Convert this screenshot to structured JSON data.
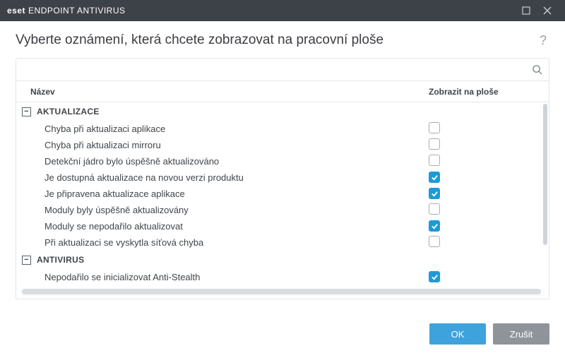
{
  "titlebar": {
    "brand_bold": "eset",
    "brand_rest": "ENDPOINT ANTIVIRUS"
  },
  "header": {
    "title": "Vyberte oznámení, která chcete zobrazovat na pracovní ploše"
  },
  "search": {
    "placeholder": ""
  },
  "columns": {
    "name": "Název",
    "show": "Zobrazit na ploše"
  },
  "groups": [
    {
      "label": "AKTUALIZACE",
      "items": [
        {
          "label": "Chyba při aktualizaci aplikace",
          "checked": false
        },
        {
          "label": "Chyba při aktualizaci mirroru",
          "checked": false
        },
        {
          "label": "Detekční jádro bylo úspěšně aktualizováno",
          "checked": false
        },
        {
          "label": "Je dostupná aktualizace na novou verzi produktu",
          "checked": true
        },
        {
          "label": "Je připravena aktualizace aplikace",
          "checked": true
        },
        {
          "label": "Moduly byly úspěšně aktualizovány",
          "checked": false
        },
        {
          "label": "Moduly se nepodařilo aktualizovat",
          "checked": true
        },
        {
          "label": "Při aktualizaci se vyskytla síťová chyba",
          "checked": false
        }
      ]
    },
    {
      "label": "ANTIVIRUS",
      "items": [
        {
          "label": "Nepodařilo se inicializovat Anti-Stealth",
          "checked": true
        }
      ]
    }
  ],
  "footer": {
    "ok": "OK",
    "cancel": "Zrušit"
  }
}
